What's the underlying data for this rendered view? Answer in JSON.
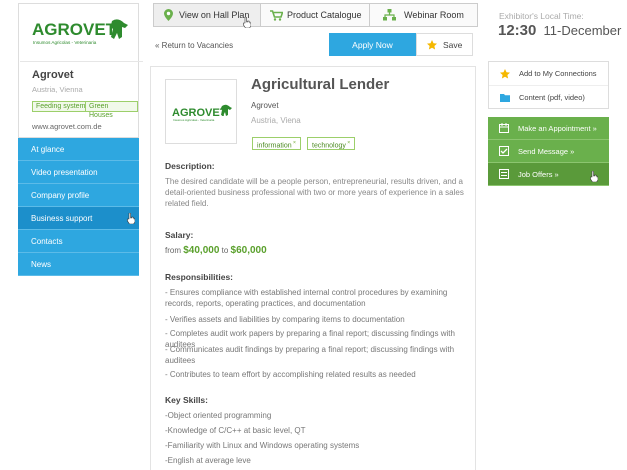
{
  "company": {
    "logo_text": "AGROVET",
    "logo_subtitle": "Insumos Agricolas - Veterinaria",
    "name": "Agrovet",
    "location": "Austria, Vienna",
    "tags": [
      "Feeding system",
      "Green Houses"
    ],
    "url": "www.agrovet.com.de"
  },
  "left_nav": {
    "items": [
      {
        "label": "At glance"
      },
      {
        "label": "Video presentation"
      },
      {
        "label": "Company profile"
      },
      {
        "label": "Business support"
      },
      {
        "label": "Contacts"
      },
      {
        "label": "News"
      }
    ],
    "active_index": 3
  },
  "top_nav": {
    "hall_plan": "View on Hall Plan",
    "catalogue": "Product Catalogue",
    "webinar": "Webinar Room"
  },
  "actions": {
    "return_link": "« Return to Vacancies",
    "apply": "Apply Now",
    "save": "Save"
  },
  "job": {
    "title": "Agricultural Lender",
    "company": "Agrovet",
    "location": "Austria, Viena",
    "tags": [
      "information",
      "technology"
    ],
    "description_heading": "Description:",
    "description": "The desired candidate will be a people person, entrepreneurial, results driven, and a detail-oriented business professional with two or more years of experience in a sales related field.",
    "salary_heading": "Salary:",
    "salary_from_label": "from",
    "salary_from": "$40,000",
    "salary_to_label": "to",
    "salary_to": "$60,000",
    "responsibilities_heading": "Responsibilities:",
    "responsibilities": [
      "- Ensures compliance with established internal control procedures by examining records, reports, operating practices, and documentation",
      "- Verifies assets and liabilities by comparing items to documentation",
      "- Completes audit work papers by preparing a final report; discussing findings with auditees",
      "- Communicates audit findings by preparing a final report; discussing findings with auditees",
      "- Contributes to team effort by accomplishing related results as needed"
    ],
    "skills_heading": "Key Skills:",
    "skills": [
      "-Object oriented programming",
      "-Knowledge of C/C++ at basic level, QT",
      "-Familiarity with Linux and Windows operating systems",
      "-English at average leve"
    ]
  },
  "exhibitor_time": {
    "label": "Exhibitor's Local Time:",
    "time": "12:30",
    "date": "11-December"
  },
  "right_links": [
    {
      "label": "Add to My Connections",
      "icon": "star-icon"
    },
    {
      "label": "Content (pdf, video)",
      "icon": "folder-icon"
    }
  ],
  "right_actions": [
    {
      "label": "Make an Appointment »",
      "icon": "calendar-icon"
    },
    {
      "label": "Send Message »",
      "icon": "checkbox-icon"
    },
    {
      "label": "Job Offers »",
      "icon": "list-icon"
    }
  ],
  "colors": {
    "blue": "#2ea7e0",
    "blue_active": "#1c8fcb",
    "green": "#6ab04c",
    "green_text": "#5aa02c",
    "star": "#f5b800"
  }
}
